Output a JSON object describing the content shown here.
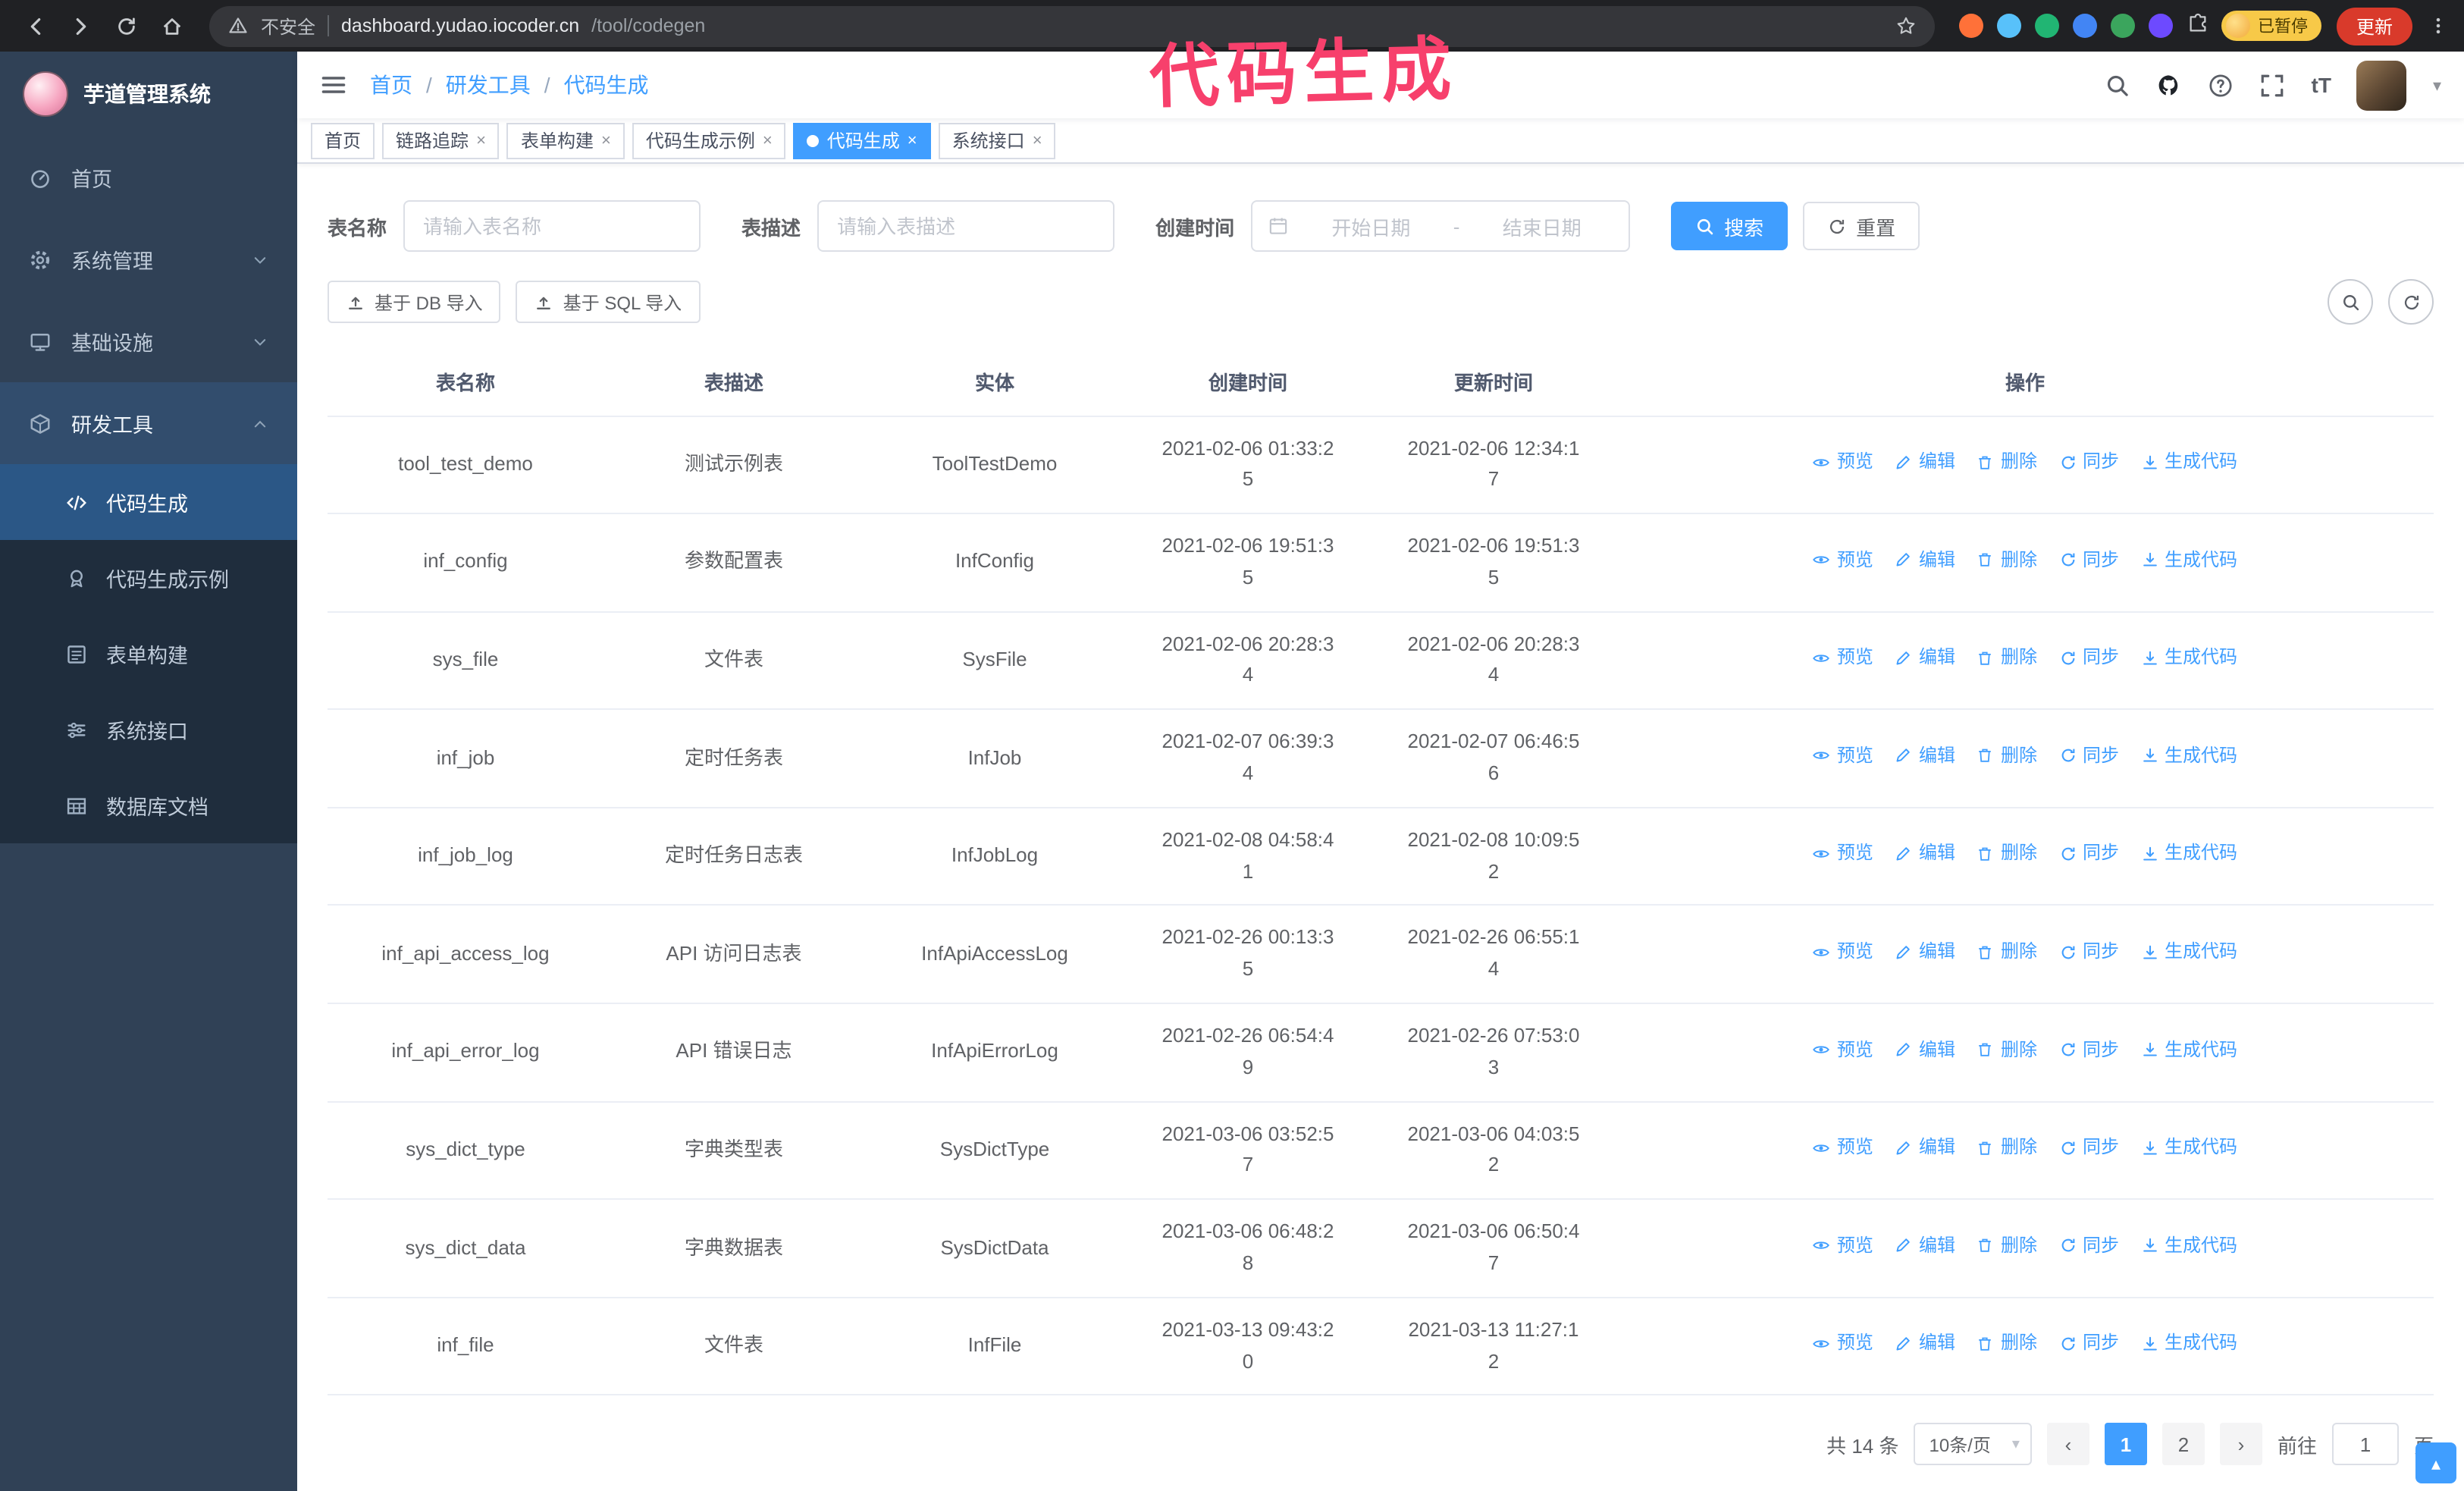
{
  "annotation": {
    "text": "代码生成"
  },
  "browser": {
    "security_label": "不安全",
    "url_host": "dashboard.yudao.iocoder.cn",
    "url_path": "/tool/codegen",
    "paused_badge": "已暂停",
    "update_button": "更新"
  },
  "sidebar": {
    "logo_title": "芋道管理系统",
    "items": [
      {
        "label": "首页"
      },
      {
        "label": "系统管理"
      },
      {
        "label": "基础设施"
      },
      {
        "label": "研发工具"
      }
    ],
    "sub_items": [
      {
        "label": "代码生成"
      },
      {
        "label": "代码生成示例"
      },
      {
        "label": "表单构建"
      },
      {
        "label": "系统接口"
      },
      {
        "label": "数据库文档"
      }
    ]
  },
  "header": {
    "breadcrumb": {
      "home": "首页",
      "group": "研发工具",
      "current": "代码生成",
      "separator": "/"
    }
  },
  "tags": [
    {
      "label": "首页",
      "closable": false,
      "active": false
    },
    {
      "label": "链路追踪",
      "closable": true,
      "active": false
    },
    {
      "label": "表单构建",
      "closable": true,
      "active": false
    },
    {
      "label": "代码生成示例",
      "closable": true,
      "active": false
    },
    {
      "label": "代码生成",
      "closable": true,
      "active": true
    },
    {
      "label": "系统接口",
      "closable": true,
      "active": false
    }
  ],
  "filters": {
    "table_name_label": "表名称",
    "table_name_placeholder": "请输入表名称",
    "table_desc_label": "表描述",
    "table_desc_placeholder": "请输入表描述",
    "create_time_label": "创建时间",
    "date_start_placeholder": "开始日期",
    "date_separator": "-",
    "date_end_placeholder": "结束日期",
    "search_button": "搜索",
    "reset_button": "重置"
  },
  "toolbar": {
    "import_db_button": "基于 DB 导入",
    "import_sql_button": "基于 SQL 导入"
  },
  "table": {
    "columns": [
      "表名称",
      "表描述",
      "实体",
      "创建时间",
      "更新时间",
      "操作"
    ],
    "action_labels": [
      "预览",
      "编辑",
      "删除",
      "同步",
      "生成代码"
    ],
    "rows": [
      {
        "name": "tool_test_demo",
        "desc": "测试示例表",
        "entity": "ToolTestDemo",
        "created": "2021-02-06 01:33:25",
        "updated": "2021-02-06 12:34:17"
      },
      {
        "name": "inf_config",
        "desc": "参数配置表",
        "entity": "InfConfig",
        "created": "2021-02-06 19:51:35",
        "updated": "2021-02-06 19:51:35"
      },
      {
        "name": "sys_file",
        "desc": "文件表",
        "entity": "SysFile",
        "created": "2021-02-06 20:28:34",
        "updated": "2021-02-06 20:28:34"
      },
      {
        "name": "inf_job",
        "desc": "定时任务表",
        "entity": "InfJob",
        "created": "2021-02-07 06:39:34",
        "updated": "2021-02-07 06:46:56"
      },
      {
        "name": "inf_job_log",
        "desc": "定时任务日志表",
        "entity": "InfJobLog",
        "created": "2021-02-08 04:58:41",
        "updated": "2021-02-08 10:09:52"
      },
      {
        "name": "inf_api_access_log",
        "desc": "API 访问日志表",
        "entity": "InfApiAccessLog",
        "created": "2021-02-26 00:13:35",
        "updated": "2021-02-26 06:55:14"
      },
      {
        "name": "inf_api_error_log",
        "desc": "API 错误日志",
        "entity": "InfApiErrorLog",
        "created": "2021-02-26 06:54:49",
        "updated": "2021-02-26 07:53:03"
      },
      {
        "name": "sys_dict_type",
        "desc": "字典类型表",
        "entity": "SysDictType",
        "created": "2021-03-06 03:52:57",
        "updated": "2021-03-06 04:03:52"
      },
      {
        "name": "sys_dict_data",
        "desc": "字典数据表",
        "entity": "SysDictData",
        "created": "2021-03-06 06:48:28",
        "updated": "2021-03-06 06:50:47"
      },
      {
        "name": "inf_file",
        "desc": "文件表",
        "entity": "InfFile",
        "created": "2021-03-13 09:43:20",
        "updated": "2021-03-13 11:27:12"
      }
    ]
  },
  "pagination": {
    "total_text": "共 14 条",
    "page_size": "10条/页",
    "pages": [
      "1",
      "2"
    ],
    "active_page": "1",
    "goto_label": "前往",
    "goto_value": "1",
    "goto_suffix": "页"
  },
  "colors": {
    "primary": "#409eff",
    "annotation": "#f7406c",
    "sidebar_bg": "#304156",
    "submenu_bg": "#1f2d3d"
  }
}
